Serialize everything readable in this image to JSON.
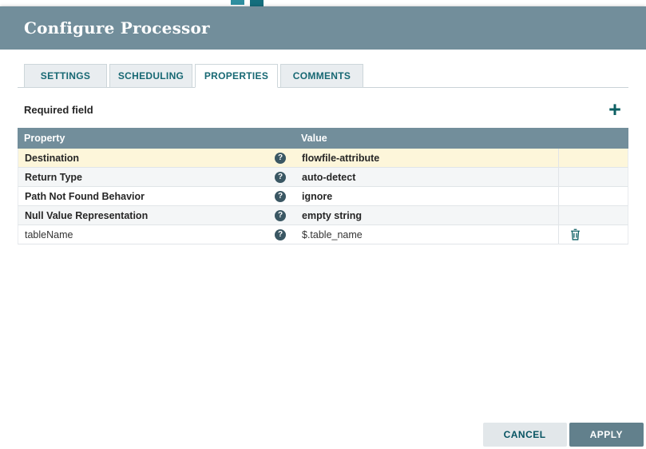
{
  "dialog": {
    "title": "Configure Processor",
    "tabs": [
      {
        "label": "SETTINGS",
        "active": false
      },
      {
        "label": "SCHEDULING",
        "active": false
      },
      {
        "label": "PROPERTIES",
        "active": true
      },
      {
        "label": "COMMENTS",
        "active": false
      }
    ],
    "required_field_label": "Required field",
    "icons": {
      "plus_glyph": "+",
      "help_glyph": "?"
    },
    "table": {
      "headers": [
        "Property",
        "Value"
      ],
      "rows": [
        {
          "property": "Destination",
          "value": "flowfile-attribute",
          "required": true,
          "highlighted": true,
          "deletable": false
        },
        {
          "property": "Return Type",
          "value": "auto-detect",
          "required": true,
          "highlighted": false,
          "deletable": false
        },
        {
          "property": "Path Not Found Behavior",
          "value": "ignore",
          "required": true,
          "highlighted": false,
          "deletable": false
        },
        {
          "property": "Null Value Representation",
          "value": "empty string",
          "required": true,
          "highlighted": false,
          "deletable": false
        },
        {
          "property": "tableName",
          "value": "$.table_name",
          "required": false,
          "highlighted": false,
          "deletable": true
        }
      ]
    },
    "buttons": {
      "cancel": "CANCEL",
      "apply": "APPLY"
    }
  },
  "colors": {
    "header_bg": "#728e9b",
    "accent_teal": "#0c5f63",
    "tab_text": "#176873",
    "highlight_row": "#fdf6da",
    "alt_row": "#f4f6f7",
    "table_header_bg": "#728e9b",
    "help_icon_bg": "#3a5763",
    "cancel_bg": "#e2e7ea",
    "apply_bg": "#62808c",
    "artifact_1": "#2f8fa0",
    "artifact_2": "#156e7d"
  }
}
